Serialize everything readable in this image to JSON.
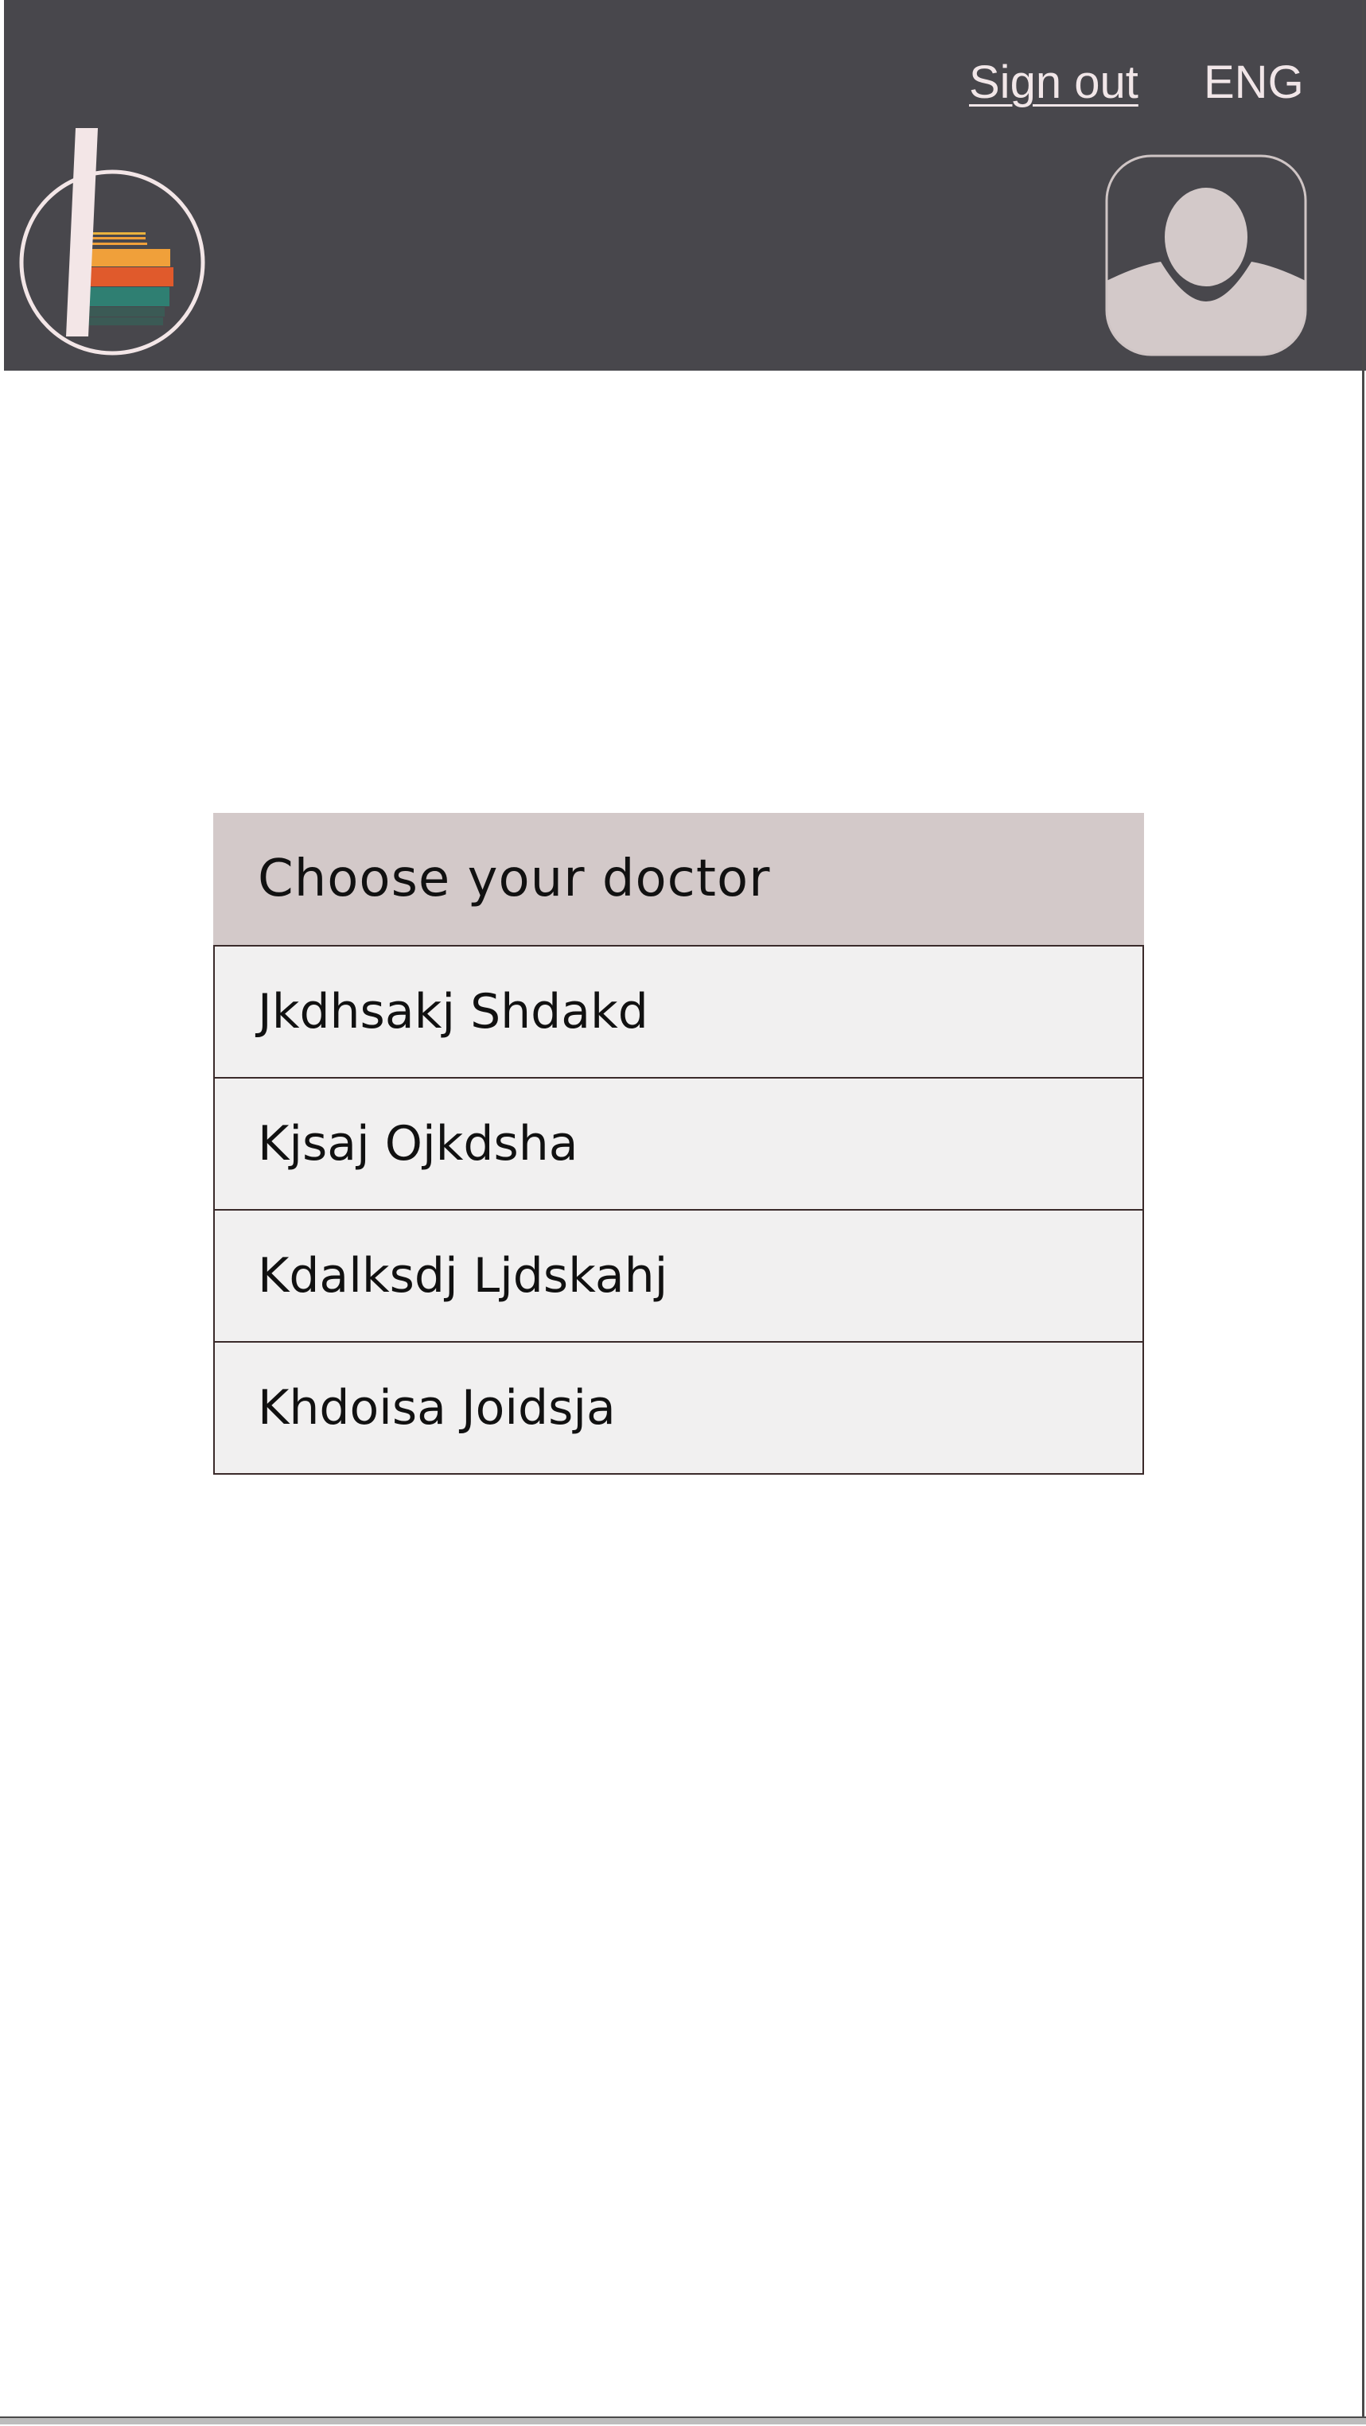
{
  "header": {
    "sign_out_label": "Sign out",
    "language_label": "ENG",
    "logo_icon": "clinic-logo-icon",
    "avatar_icon": "user-avatar-icon"
  },
  "main": {
    "title": "Choose your doctor",
    "doctors": [
      "Jkdhsakj Shdakd",
      "Kjsaj Ojkdsha",
      "Kdalksdj Ljdskahj",
      "Khdoisa Joidsja"
    ]
  },
  "colors": {
    "header_bg": "#48474c",
    "panel_header_bg": "#d3c9c9",
    "list_item_bg": "#f1f0f0",
    "light_text": "#f1e6e8",
    "logo_orange": "#f0a03a",
    "logo_red": "#e05a2c",
    "logo_teal": "#2f7f72",
    "logo_dark_teal": "#3b5a55"
  }
}
